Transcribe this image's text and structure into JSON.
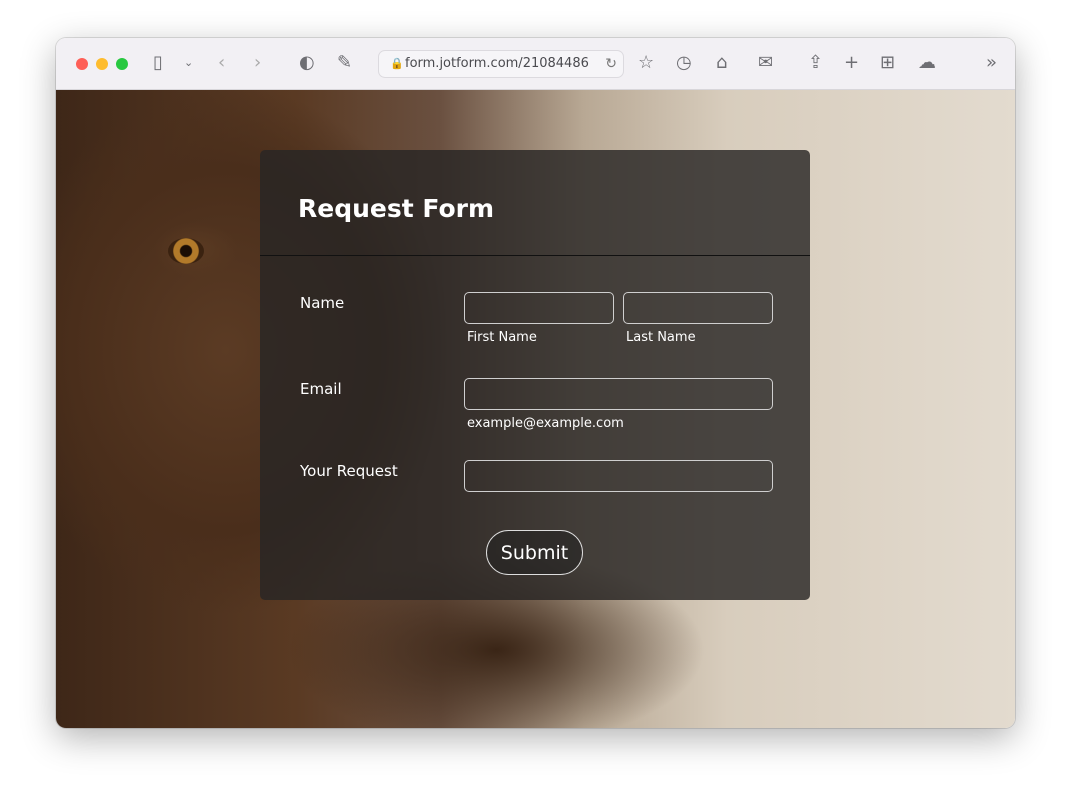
{
  "browser": {
    "url": "form.jotform.com/21084486",
    "colors": {
      "close": "#fe5f57",
      "min": "#febc2e",
      "max": "#28c840"
    }
  },
  "form": {
    "title": "Request Form",
    "name_label": "Name",
    "first_name_sublabel": "First Name",
    "last_name_sublabel": "Last Name",
    "email_label": "Email",
    "email_sublabel": "example@example.com",
    "request_label": "Your Request",
    "submit_label": "Submit",
    "first_name_value": "",
    "last_name_value": "",
    "email_value": "",
    "request_value": ""
  }
}
